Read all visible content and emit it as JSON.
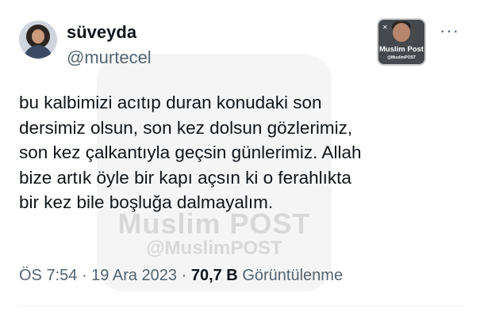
{
  "watermark": {
    "brand": "Muslim POST",
    "handle": "@MuslimPOST"
  },
  "user": {
    "display_name": "süveyda",
    "handle": "@murtecel"
  },
  "brand_badge": {
    "name": "Muslim Post",
    "handle": "@MuslimPOST"
  },
  "more_label": "···",
  "tweet": {
    "lines": [
      "bu kalbimizi acıtıp duran konudaki son",
      "dersimiz olsun, son kez dolsun gözlerimiz,",
      "son kez çalkantıyla geçsin günlerimiz. Allah",
      "bize artık öyle bir kapı açsın ki o ferahlıkta",
      "bir kez bile boşluğa dalmayalım."
    ]
  },
  "meta": {
    "time": "ÖS 7:54",
    "separator": " · ",
    "date": "19 Ara 2023",
    "views_count": "70,7 B",
    "views_label": "Görüntülenme"
  }
}
